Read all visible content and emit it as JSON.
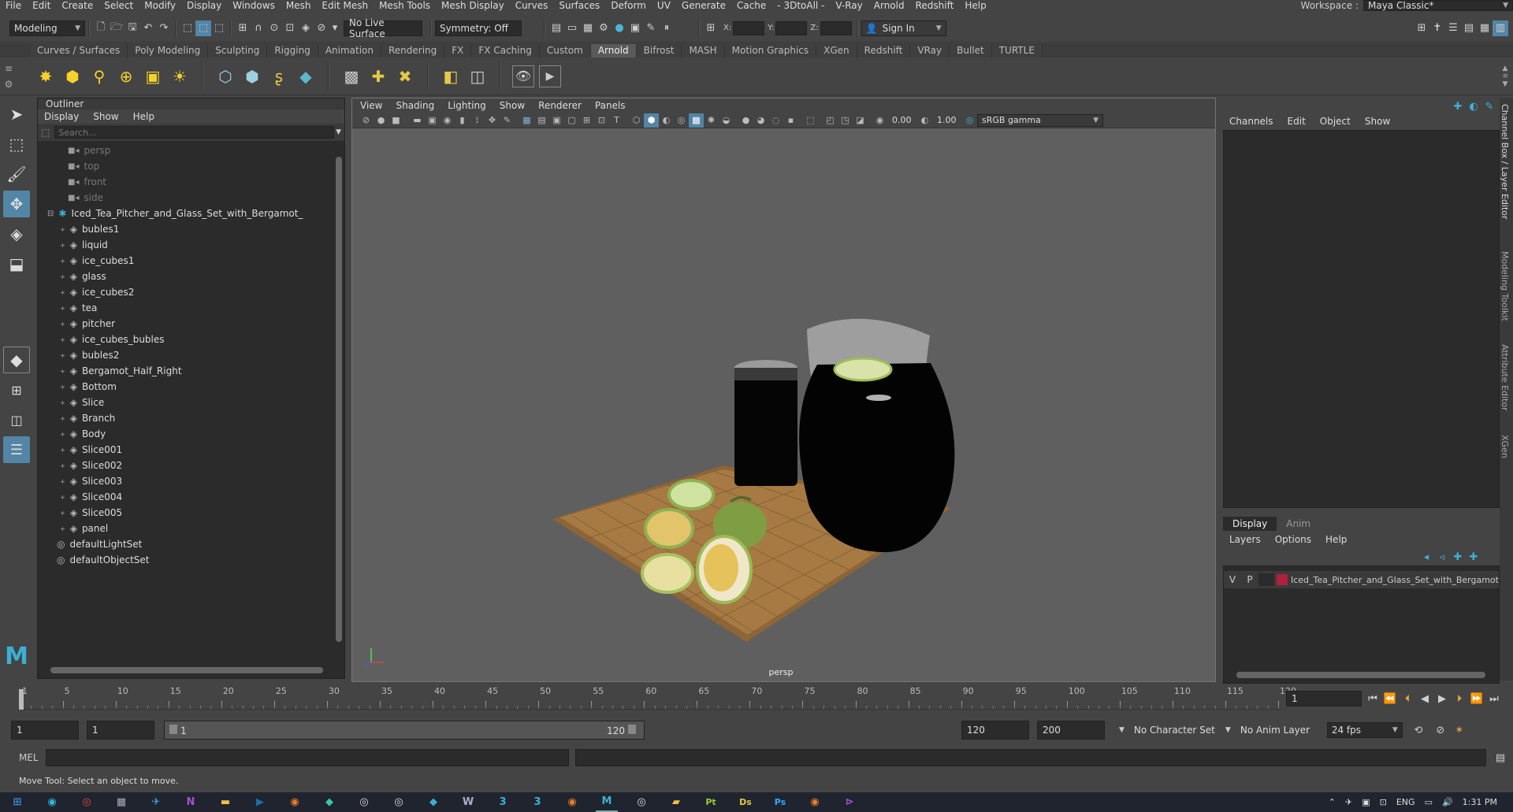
{
  "menubar": {
    "items": [
      "File",
      "Edit",
      "Create",
      "Select",
      "Modify",
      "Display",
      "Windows",
      "Mesh",
      "Edit Mesh",
      "Mesh Tools",
      "Mesh Display",
      "Curves",
      "Surfaces",
      "Deform",
      "UV",
      "Generate",
      "Cache",
      "- 3DtoAll -",
      "V-Ray",
      "Arnold",
      "Redshift",
      "Help"
    ],
    "workspace_label": "Workspace :",
    "workspace_value": "Maya Classic*"
  },
  "statusline": {
    "mode": "Modeling",
    "live_surface": "No Live Surface",
    "symmetry": "Symmetry: Off",
    "x_label": "X:",
    "y_label": "Y:",
    "z_label": "Z:",
    "sign_in": "Sign In"
  },
  "shelf": {
    "tabs": [
      "Curves / Surfaces",
      "Poly Modeling",
      "Sculpting",
      "Rigging",
      "Animation",
      "Rendering",
      "FX",
      "FX Caching",
      "Custom",
      "Arnold",
      "Bifrost",
      "MASH",
      "Motion Graphics",
      "XGen",
      "Redshift",
      "VRay",
      "Bullet",
      "TURTLE"
    ],
    "active_tab": "Arnold"
  },
  "outliner": {
    "title": "Outliner",
    "menus": [
      "Display",
      "Show",
      "Help"
    ],
    "search_placeholder": "Search...",
    "cameras": [
      "persp",
      "top",
      "front",
      "side"
    ],
    "group": "Iced_Tea_Pitcher_and_Glass_Set_with_Bergamot_",
    "children": [
      "bubles1",
      "liquid",
      "ice_cubes1",
      "glass",
      "ice_cubes2",
      "tea",
      "pitcher",
      "ice_cubes_bubles",
      "bubles2",
      "Bergamot_Half_Right",
      "Bottom",
      "Slice",
      "Branch",
      "Body",
      "Slice001",
      "Slice002",
      "Slice003",
      "Slice004",
      "Slice005",
      "panel"
    ],
    "sets": [
      "defaultLightSet",
      "defaultObjectSet"
    ]
  },
  "viewport": {
    "menus": [
      "View",
      "Shading",
      "Lighting",
      "Show",
      "Renderer",
      "Panels"
    ],
    "exposure": "0.00",
    "gamma": "1.00",
    "color_space": "sRGB gamma",
    "camera_label": "persp"
  },
  "channel_box": {
    "menus": [
      "Channels",
      "Edit",
      "Object",
      "Show"
    ]
  },
  "layer_editor": {
    "tabs": [
      "Display",
      "Anim"
    ],
    "menus": [
      "Layers",
      "Options",
      "Help"
    ],
    "layer_v": "V",
    "layer_p": "P",
    "layer_name": "Iced_Tea_Pitcher_and_Glass_Set_with_Bergamot",
    "layer_color": "#b0203a"
  },
  "right_strip": [
    "Channel Box / Layer Editor",
    "Modeling Toolkit",
    "Attribute Editor",
    "XGen"
  ],
  "timeslider": {
    "ticks": [
      "1",
      "5",
      "10",
      "15",
      "20",
      "25",
      "30",
      "35",
      "40",
      "45",
      "50",
      "55",
      "60",
      "65",
      "70",
      "75",
      "80",
      "85",
      "90",
      "95",
      "100",
      "105",
      "110",
      "115",
      "120"
    ],
    "current_frame": "1"
  },
  "range": {
    "start": "1",
    "playback_start": "1",
    "slider_start": "1",
    "slider_end": "120",
    "playback_end": "120",
    "end": "200",
    "character_set": "No Character Set",
    "anim_layer": "No Anim Layer",
    "fps": "24 fps"
  },
  "cmdline": {
    "label": "MEL"
  },
  "helpline": {
    "text": "Move Tool: Select an object to move."
  },
  "taskbar": {
    "lang": "ENG",
    "time": "1:31 PM"
  },
  "colors": {
    "accent": "#5285a6",
    "panel": "#2b2b2b",
    "ui": "#444444"
  }
}
